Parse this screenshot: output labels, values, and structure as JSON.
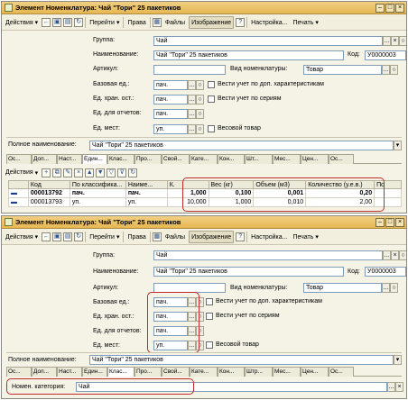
{
  "window1": {
    "title": "Элемент Номенклатура: Чай \"Тори\" 25 пакетиков",
    "toolbar": {
      "actions": "Действия",
      "goto": "Перейти",
      "rights": "Права",
      "files": "Файлы",
      "image": "Изображение",
      "help": "?",
      "settings": "Настройка...",
      "print": "Печать"
    },
    "form": {
      "group_label": "Группа:",
      "group_value": "Чай",
      "name_label": "Наименование:",
      "name_value": "Чай \"Тори\" 25 пакетиков",
      "code_label": "Код:",
      "code_value": "У0000003",
      "article_label": "Артикул:",
      "article_value": "",
      "kind_label": "Вид номенклатуры:",
      "kind_value": "Товар",
      "base_unit_label": "Базовая ед.:",
      "base_unit_value": "пач.",
      "storage_unit_label": "Ед. хран. ост.:",
      "storage_unit_value": "пач.",
      "report_unit_label": "Ед. для отчетов:",
      "report_unit_value": "пач.",
      "place_unit_label": "Ед. мест:",
      "place_unit_value": "уп.",
      "chk_characteristics": "Вести учет по доп. характеристикам",
      "chk_series": "Вести учет по сериям",
      "chk_weight": "Весовой товар",
      "fullname_label": "Полное наименование:",
      "fullname_value": "Чай \"Тори\" 25 пакетиков"
    },
    "tabs": [
      "Ос...",
      "Доп...",
      "Наст...",
      "Един...",
      "Клас...",
      "Про...",
      "Свой...",
      "Кате...",
      "Кон...",
      "Шт...",
      "Мес...",
      "Цен...",
      "Ос..."
    ],
    "grid": {
      "actions": "Действия",
      "columns": [
        "",
        "Код",
        "По классифика...",
        "Наиме...",
        "К.",
        "Вес (кг)",
        "Объем (м3)",
        "Количество (у.е.в.)",
        "По"
      ],
      "rows": [
        [
          "",
          "000013792",
          "пач.",
          "пач.",
          "1,000",
          "0,100",
          "0,001",
          "0,20",
          ""
        ],
        [
          "",
          "000013793",
          "уп.",
          "уп.",
          "10,000",
          "1,000",
          "0,010",
          "2,00",
          ""
        ]
      ]
    }
  },
  "window2": {
    "title": "Элемент Номенклатура: Чай \"Тори\" 25 пакетиков",
    "toolbar": {
      "actions": "Действия",
      "goto": "Перейти",
      "rights": "Права",
      "files": "Файлы",
      "image": "Изображение",
      "help": "?",
      "settings": "Настройка...",
      "print": "Печать"
    },
    "form": {
      "group_label": "Группа:",
      "group_value": "Чай",
      "name_label": "Наименование:",
      "name_value": "Чай \"Тори\" 25 пакетиков",
      "code_label": "Код:",
      "code_value": "У0000003",
      "article_label": "Артикул:",
      "article_value": "",
      "kind_label": "Вид номенклатуры:",
      "kind_value": "Товар",
      "base_unit_label": "Базовая ед.:",
      "base_unit_value": "пач.",
      "storage_unit_label": "Ед. хран. ост.:",
      "storage_unit_value": "пач.",
      "report_unit_label": "Ед. для отчетов:",
      "report_unit_value": "пач.",
      "place_unit_label": "Ед. мест:",
      "place_unit_value": "уп.",
      "chk_characteristics": "Вести учет по доп. характеристикам",
      "chk_series": "Вести учет по сериям",
      "chk_weight": "Весовой товар",
      "fullname_label": "Полное наименование:",
      "fullname_value": "Чай \"Тори\" 25 пакетиков"
    },
    "tabs": [
      "Ос...",
      "Доп...",
      "Наст...",
      "Един...",
      "Клас...",
      "Про...",
      "Свой...",
      "Кате...",
      "Кон...",
      "Штр...",
      "Мес...",
      "Цен...",
      "Ос..."
    ],
    "category_label": "Номен. категория:",
    "category_value": "Чай"
  },
  "colors": {
    "title_bar": "#e6b752",
    "highlight_box": "#c42a2a",
    "window_bg": "#f5f3e6"
  }
}
